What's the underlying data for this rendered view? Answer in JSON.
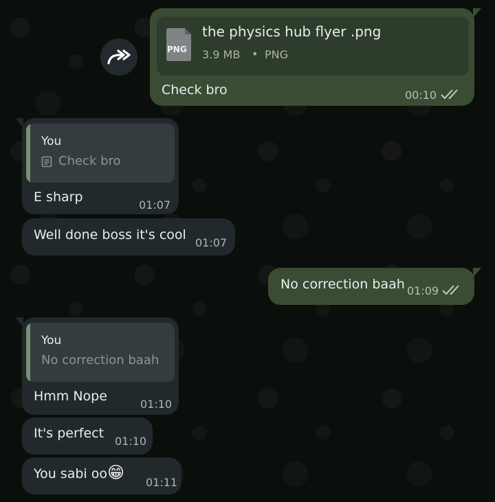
{
  "forward_button": {
    "icon": "forward-icon"
  },
  "messages": [
    {
      "direction": "outgoing",
      "attachment": {
        "filename": "the physics hub flyer .png",
        "size": "3.9 MB",
        "separator": "•",
        "type": "PNG",
        "icon_label": "PNG"
      },
      "text": "Check bro",
      "time": "00:10",
      "status": "read"
    },
    {
      "direction": "incoming",
      "reply_to": {
        "author": "You",
        "text": "Check bro",
        "icon": "document-icon"
      },
      "text": "E sharp",
      "time": "01:07"
    },
    {
      "direction": "incoming",
      "text": "Well done boss it's cool",
      "time": "01:07"
    },
    {
      "direction": "outgoing",
      "text": "No correction baah",
      "time": "01:09",
      "status": "read"
    },
    {
      "direction": "incoming",
      "reply_to": {
        "author": "You",
        "text": "No correction baah"
      },
      "text": "Hmm Nope",
      "time": "01:10"
    },
    {
      "direction": "incoming",
      "text": "It's perfect",
      "time": "01:10"
    },
    {
      "direction": "incoming",
      "text": "You sabi oo",
      "emoji": "😁",
      "time": "01:11"
    }
  ],
  "colors": {
    "background": "#0b0f0c",
    "outgoing_bubble": "#3b4c34",
    "incoming_bubble": "#22292c",
    "quote_bar": "#7b8f72"
  }
}
